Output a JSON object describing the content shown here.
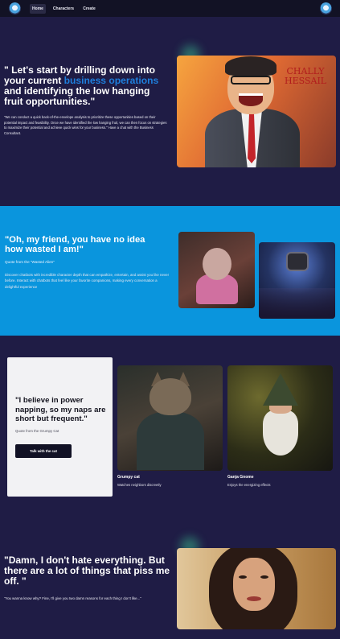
{
  "nav": {
    "items": [
      {
        "label": "Home",
        "active": true
      },
      {
        "label": "Characters",
        "active": false
      },
      {
        "label": "Create",
        "active": false
      }
    ]
  },
  "hero": {
    "heading_part1": "\" Let's start by drilling down into your current ",
    "heading_accent": "business operations",
    "heading_part2": " and identifying the low hanging fruit opportunities.\"",
    "body": "\"We can conduct a quick back-of-the-envelope analysis to prioritize these opportunities based on their potential impact and feasibility. Once we have identified the low hanging fruit, we can then focus on strategies to maximize their potential and achieve quick wins for your business.\" Have a chat with the Business Consultant.",
    "image_sign": "CHALLY HESSAIL"
  },
  "alien": {
    "heading": "\"Oh, my friend, you have no idea how wasted I am!\"",
    "source": "Quote from the \"Wasted Alien\"",
    "body": "Discover chatbots with incredible character depth that can empathize, entertain, and assist you like never before. Interact with chatbots that feel like your favorite companions, making every conversation a delightful experience"
  },
  "grumpy": {
    "quote": "\"I believe in power napping, so my naps are short but frequent.\"",
    "source": "Quote from the Grumpy Cat",
    "button": "Talk with the cat",
    "cards": [
      {
        "title": "Grumpy cat",
        "subtitle": "Watches neighbors discreetly"
      },
      {
        "title": "Ganja Gnome",
        "subtitle": "Enjoys the energizing effects"
      }
    ]
  },
  "damn": {
    "heading": "\"Damn, I don't hate everything. But there are a lot of things that piss me off. \"",
    "body": "\"You wanna know why? Fine, I'll give you two damn reasons for each thing I don't like...\""
  },
  "colors": {
    "background": "#1f1c45",
    "nav": "#121225",
    "accent": "#1f7fdd",
    "blue_section": "#0a95dd",
    "card": "#f2f2f4"
  }
}
